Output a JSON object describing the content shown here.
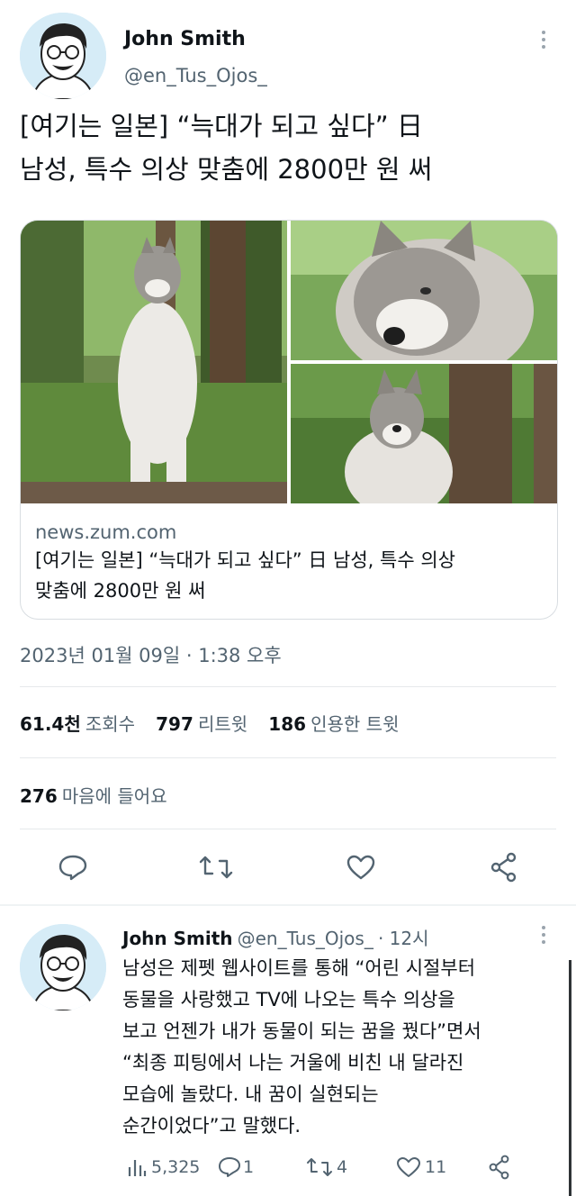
{
  "tweet": {
    "author": {
      "name": "John Smith",
      "handle": "@en_Tus_Ojos_"
    },
    "more_icon": "more-vertical-icon",
    "text_line1": "[여기는 일본] “늑대가 되고 싶다” 日",
    "text_line2": "남성, 특수 의상 맞춤에 2800만 원 써",
    "card": {
      "domain": "news.zum.com",
      "title_line1": "[여기는 일본] “늑대가 되고 싶다” 日 남성, 특수 의상",
      "title_line2": "맞춤에 2800만 원 써"
    },
    "timestamp": "2023년 01월 09일 · 1:38 오후",
    "stats": {
      "views_num": "61.4천",
      "views_label": "조회수",
      "retweets_num": "797",
      "retweets_label": "리트윗",
      "quotes_num": "186",
      "quotes_label": "인용한 트윗",
      "likes_num": "276",
      "likes_label": "마음에 들어요"
    },
    "actions": [
      "reply-icon",
      "retweet-icon",
      "like-icon",
      "share-icon"
    ]
  },
  "reply": {
    "author": {
      "name": "John Smith",
      "handle": "@en_Tus_Ojos_",
      "time": "· 12시"
    },
    "lines": [
      "남성은 제펫 웹사이트를 통해 “어린 시절부터",
      "동물을 사랑했고 TV에 나오는 특수 의상을",
      "보고 언젠가 내가 동물이 되는 꿈을 꿨다”면서",
      "“최종 피팅에서 나는 거울에 비친 내 달라진",
      "모습에 놀랐다. 내 꿈이 실현되는",
      "순간이었다”고 말했다."
    ],
    "actions": {
      "views": "5,325",
      "replies": "1",
      "retweets": "4",
      "likes": "11"
    }
  },
  "colors": {
    "text": "#0f1419",
    "secondary": "#536471",
    "divider": "#e6e9eb",
    "avatar_bg": "#d6ecf7"
  }
}
